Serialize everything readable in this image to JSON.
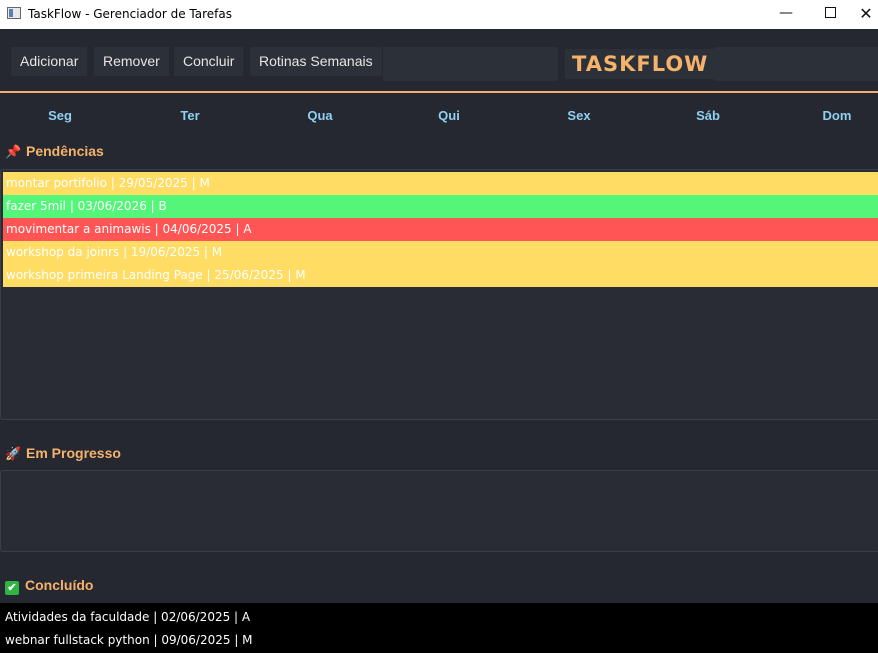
{
  "window": {
    "title": "TaskFlow - Gerenciador de Tarefas",
    "minimize": "—",
    "close": "✕"
  },
  "toolbar": {
    "add_label": "Adicionar",
    "remove_label": "Remover",
    "complete_label": "Concluir",
    "routines_label": "Rotinas Semanais",
    "brand": "TASKFLOW"
  },
  "days": [
    "Seg",
    "Ter",
    "Qua",
    "Qui",
    "Sex",
    "Sáb",
    "Dom"
  ],
  "sections": {
    "pending": {
      "title": "Pendências",
      "icon": "pushpin-icon",
      "tasks": [
        {
          "text": "montar portifolio | 29/05/2025 | M",
          "priority": "M",
          "bg": "#ffdc64",
          "fg": "#ffffff"
        },
        {
          "text": "fazer 5mil | 03/06/2026 | B",
          "priority": "B",
          "bg": "#55f57a",
          "fg": "#ffffff"
        },
        {
          "text": "movimentar a animawis | 04/06/2025 | A",
          "priority": "A",
          "bg": "#ff5555",
          "fg": "#ffffff"
        },
        {
          "text": "workshop da joinrs  | 19/06/2025 | M",
          "priority": "M",
          "bg": "#ffdc64",
          "fg": "#ffffff"
        },
        {
          "text": "workshop primeira Landing Page | 25/06/2025 | M",
          "priority": "M",
          "bg": "#ffdc64",
          "fg": "#ffffff"
        }
      ]
    },
    "in_progress": {
      "title": "Em Progresso",
      "icon": "rocket-icon",
      "tasks": []
    },
    "done": {
      "title": "Concluído",
      "icon": "check-icon",
      "tasks": [
        {
          "text": "Atividades da faculdade | 02/06/2025 | A"
        },
        {
          "text": "webnar fullstack python | 09/06/2025 | M"
        }
      ]
    }
  },
  "colors": {
    "background": "#252830",
    "accent": "#f5b26b",
    "day_label": "#8fd0f0",
    "priority_high": "#ff5555",
    "priority_medium": "#ffdc64",
    "priority_low": "#55f57a"
  }
}
